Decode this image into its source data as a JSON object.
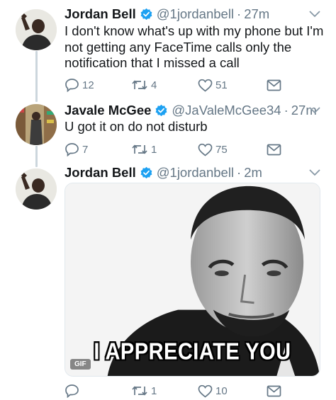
{
  "tweets": [
    {
      "name": "Jordan Bell",
      "handle": "@1jordanbell",
      "separator": "·",
      "time": "27m",
      "text": "I don't know what's up with my phone but I'm not getting any FaceTime calls only the notification that I missed a call",
      "replies": "12",
      "retweets": "4",
      "likes": "51"
    },
    {
      "name": "Javale McGee",
      "handle": "@JaValeMcGee34",
      "separator": "·",
      "time": "27m",
      "text": "U got it on do not disturb",
      "replies": "",
      "retweets": "1",
      "likes": "75",
      "replies_display": "7"
    },
    {
      "name": "Jordan Bell",
      "handle": "@1jordanbell",
      "separator": "·",
      "time": "2m",
      "media": {
        "caption": "I APPRECIATE YOU",
        "badge": "GIF"
      },
      "replies": "",
      "retweets": "1",
      "likes": "10"
    }
  ],
  "icons": {
    "verified": "verified-badge-icon",
    "reply": "reply-icon",
    "retweet": "retweet-icon",
    "like": "heart-icon",
    "dm": "envelope-icon",
    "caret": "chevron-down-icon"
  },
  "colors": {
    "verified": "#1da1f2",
    "muted": "#657786",
    "thread_line": "#ccd6dd"
  }
}
